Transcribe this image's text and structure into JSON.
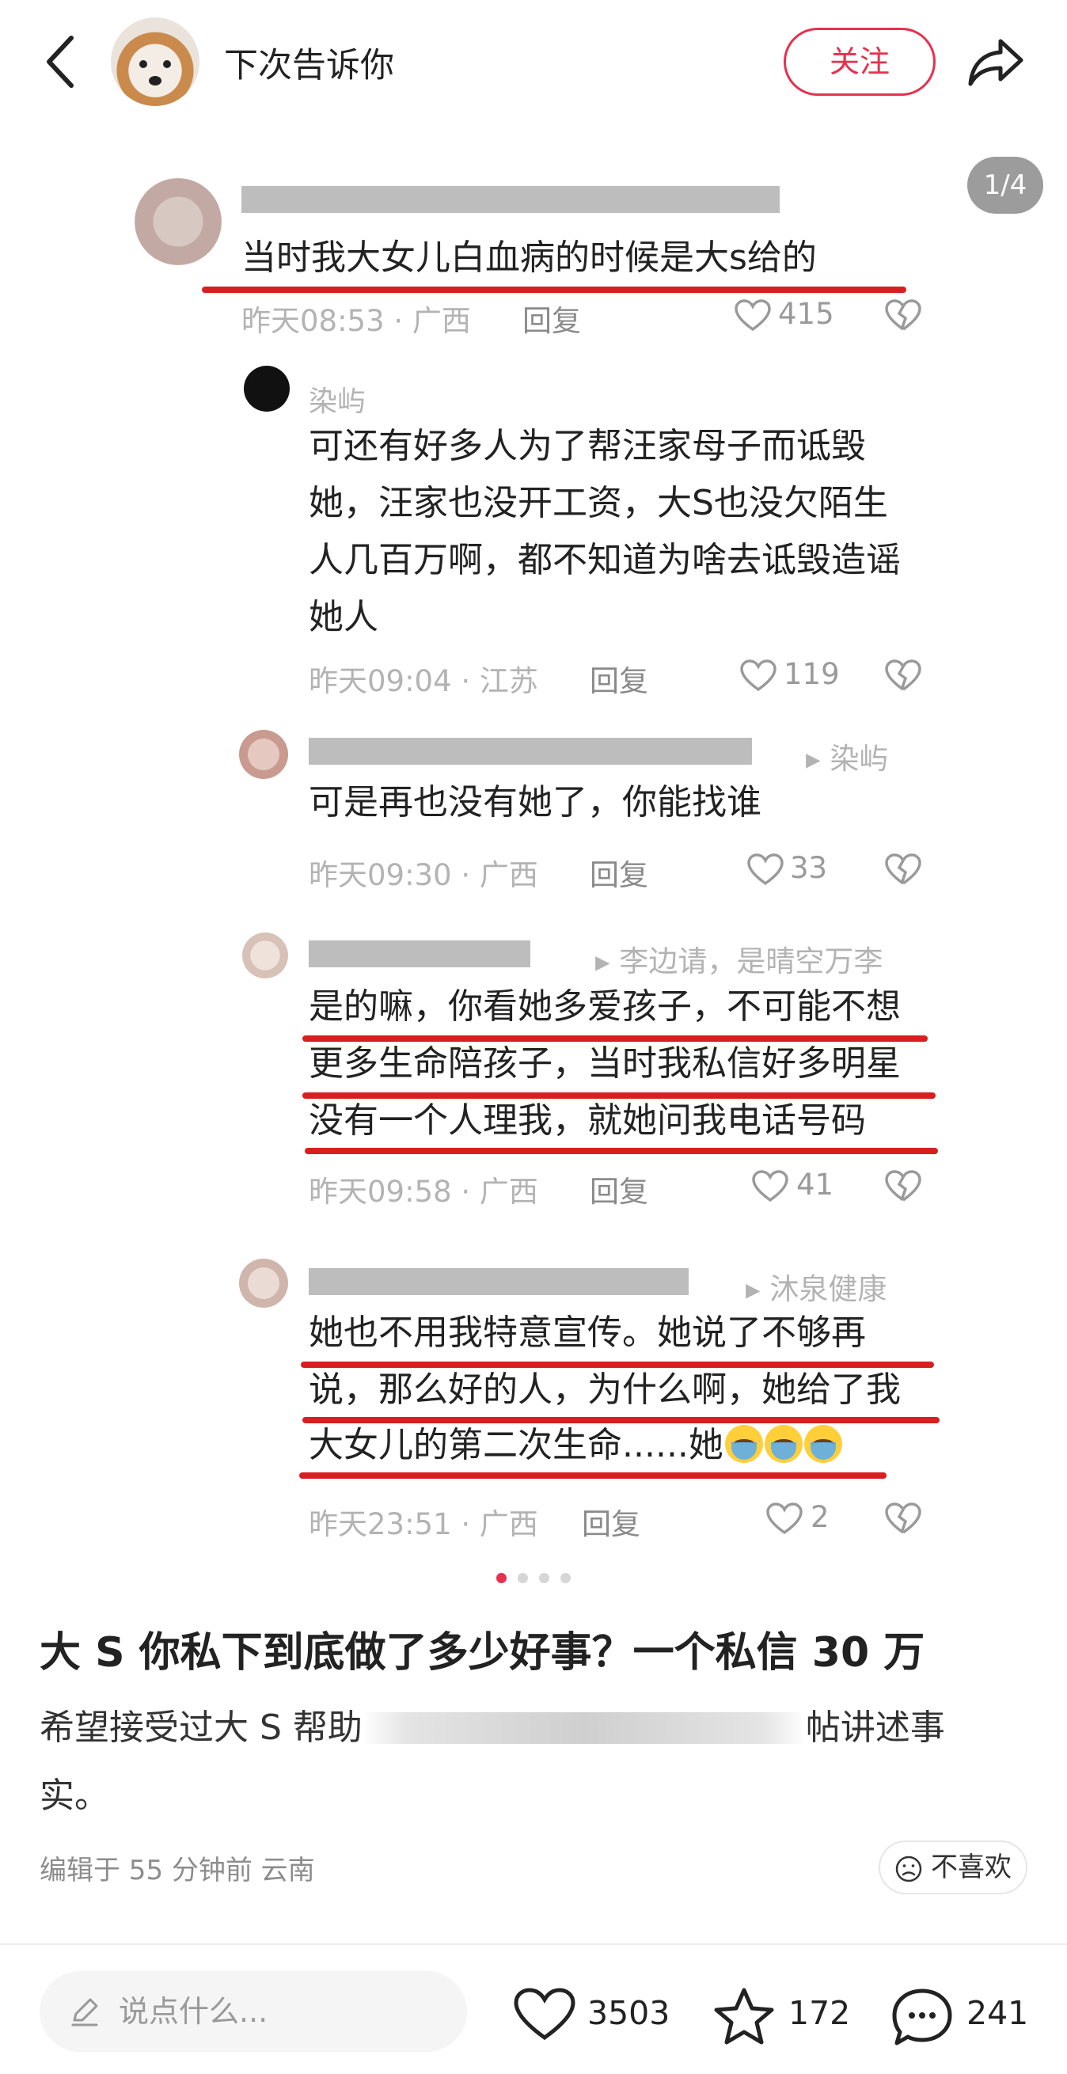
{
  "header": {
    "author_name": "下次告诉你",
    "follow_label": "关注"
  },
  "image": {
    "page_indicator": "1/4",
    "comments": [
      {
        "text": "当时我大女儿白血病的时候是大s给的",
        "time": "昨天08:53 · 广西",
        "reply_label": "回复",
        "likes": "415"
      },
      {
        "name": "染屿",
        "lines": [
          "可还有好多人为了帮汪家母子而诋毁",
          "她，汪家也没开工资，大S也没欠陌生",
          "人几百万啊，都不知道为啥去诋毁造谣",
          "她人"
        ],
        "time": "昨天09:04 · 江苏",
        "reply_label": "回复",
        "likes": "119"
      },
      {
        "reply_to": "▸ 染屿",
        "text": "可是再也没有她了，你能找谁",
        "time": "昨天09:30 · 广西",
        "reply_label": "回复",
        "likes": "33"
      },
      {
        "reply_to": "▸ 李边请，是晴空万李",
        "lines": [
          "是的嘛，你看她多爱孩子，不可能不想",
          "更多生命陪孩子，当时我私信好多明星",
          "没有一个人理我，就她问我电话号码"
        ],
        "time": "昨天09:58 · 广西",
        "reply_label": "回复",
        "likes": "41"
      },
      {
        "reply_to": "▸ 沐泉健康",
        "lines": [
          "她也不用我特意宣传。她说了不够再",
          "说，那么好的人，为什么啊，她给了我",
          "大女儿的第二次生命......她"
        ],
        "time": "昨天23:51 · 广西",
        "reply_label": "回复",
        "likes": "2"
      }
    ]
  },
  "post": {
    "title": "大 S 你私下到底做了多少好事？一个私信 30 万",
    "body_part1": "希望接受过大 S 帮助",
    "body_part2": "帖讲述事",
    "body_part3": "实。",
    "meta": "编辑于 55 分钟前 云南",
    "dislike_label": "不喜欢"
  },
  "bottom_bar": {
    "comment_placeholder": "说点什么...",
    "likes": "3503",
    "stars": "172",
    "comments": "241"
  },
  "colors": {
    "accent": "#e6314f",
    "highlight_line": "#d81f1f"
  }
}
